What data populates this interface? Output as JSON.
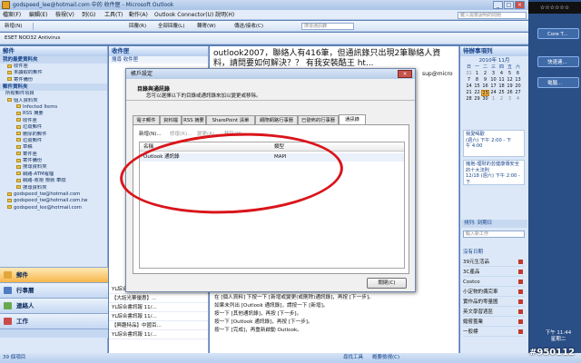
{
  "window": {
    "title": "godspeed_lee@hotmail.com 中的 收件匣 - Microsoft Outlook",
    "min": "_",
    "max": "□",
    "close": "×"
  },
  "menu": {
    "items": [
      "檔案(F)",
      "編輯(E)",
      "檢視(V)",
      "到(G)",
      "工具(T)",
      "動作(A)",
      "Outlook Connector(U)",
      "說明(H)"
    ],
    "help_placeholder": "鍵入需要說明的問題"
  },
  "toolbar1": {
    "new": "新增(N)",
    "reply": "回覆(R)",
    "reply_all": "全部回覆(L)",
    "forward": "轉寄(W)",
    "send_receive": "傳送/接收(C)",
    "search_placeholder": "搜尋通訊錄"
  },
  "toolbar2": {
    "antivirus": "ESET NOD32 Antivirus"
  },
  "nav": {
    "header": "郵件",
    "favorites_header": "我的最愛資料夾",
    "favorites": [
      "收件匣",
      "未讀取的郵件",
      "寄件備份"
    ],
    "folders_header": "郵件資料夾",
    "all_items": "所有郵件項目",
    "tree": [
      "個人資料夾",
      "Infected Items",
      "RSS 摘要",
      "收件匣",
      "垃圾郵件",
      "刪除的郵件",
      "垃圾郵件",
      "草稿",
      "寄件匣",
      "寄件備份",
      "搜尋資料夾",
      "網路-ATM電檔",
      "網路-收視 規就 車險",
      "搜尋資料夾"
    ],
    "accounts": [
      "godspeed_tw@hotmail.com",
      "godspeed_tw@hotmail.com.tw",
      "godspeed_lee@hotmail.com"
    ],
    "buttons": [
      "郵件",
      "行事曆",
      "連絡人",
      "工作"
    ]
  },
  "maillist": {
    "header": "收件匣",
    "search_label": "搜尋 收件匣",
    "rows": [
      "YL綜合書訊報 11/...",
      "【大話光華優惠】...",
      "YL綜合書訊報 11/...",
      "YL綜合書訊報 11/...",
      "【興趣特品】中國百...",
      "YL綜合書訊報 11/..."
    ]
  },
  "reading": {
    "subject": "outlook2007，聯絡人有416筆，但通訊錄只出現2筆聯絡人資料，請問要如何解決？？ 有我安裝酷王 ht...",
    "header_right": "sup@micro",
    "lines": [
      "在 [個人資料] 下按一下 [新增或變更(或刪除)通訊錄]，再按 [下一步]。",
      "如果未列出 [Outlook 通訊錄]，請按一下 [新增]。",
      "按一下 [其他通訊錄]，再按 [下一步]。",
      "按一下 [Outlook 通訊錄]，再按 [下一步]。",
      "按一下 [完成]，再重新啟動 Outlook。"
    ]
  },
  "todo": {
    "header": "待辦事項列",
    "month": "2010年 11月",
    "weekdays": [
      "日",
      "一",
      "二",
      "三",
      "四",
      "五",
      "六"
    ],
    "days": [
      31,
      1,
      2,
      3,
      4,
      5,
      6,
      7,
      8,
      9,
      10,
      11,
      12,
      13,
      14,
      15,
      16,
      17,
      18,
      19,
      20,
      21,
      22,
      23,
      24,
      25,
      26,
      27,
      28,
      29,
      30,
      1,
      2,
      3,
      4
    ],
    "today": "23",
    "appt1": [
      "我愛喝歡",
      "(週六) 下午 2:00 - 下",
      "午 4:00"
    ],
    "appt2": [
      "擁抱-理財的芸健康傳安全的十大法則",
      "12/18 (週六) 下午 2:00 - 下"
    ],
    "task_header": "排列: 到期日",
    "task_input": "輸入新工作",
    "task_group": "沒有日期",
    "tasks": [
      "39元生活品",
      "3C產品",
      "Costco",
      "小定物的偶完車",
      "實作品的零量圖",
      "英文學習週區",
      "婚嘗蓋業",
      "一般標"
    ]
  },
  "dialog": {
    "title": "帳戶設定",
    "headline": "目錄與通訊錄",
    "desc": "您可以選擇以下的目錄或通訊錄來加以變更或移除。",
    "tabs": [
      "電子郵件",
      "資料檔",
      "RSS 摘要",
      "SharePoint 清單",
      "網際網路行事曆",
      "已發佈的行事曆",
      "通訊錄"
    ],
    "toolbar": {
      "new": "新增(N)...",
      "repair": "修復(R)...",
      "change": "變更(A)...",
      "remove": "移除(M)"
    },
    "col_name": "名稱",
    "col_type": "類型",
    "row_name": "Outlook 通訊錄",
    "row_type": "MAPI",
    "close": "關閉(C)"
  },
  "status": {
    "left": "39 個項目",
    "right_btns": [
      "尋找工具",
      "概要檢視(C)"
    ]
  },
  "desktop": {
    "clock": "☆☆☆☆☆☆",
    "gadgets": [
      "Core T...",
      "快速連...",
      "電腦..."
    ],
    "time": "下午 11:44",
    "date": "星期二",
    "watermark": "#950112"
  }
}
